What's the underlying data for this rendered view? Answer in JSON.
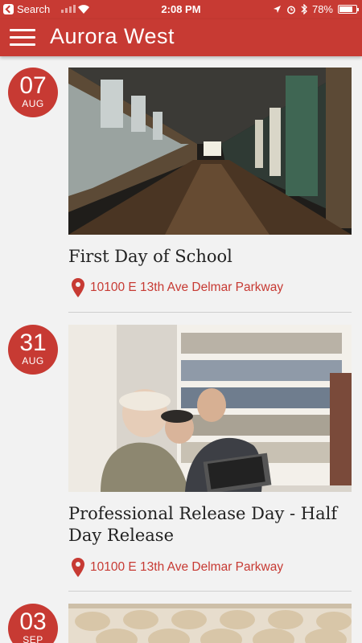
{
  "status_bar": {
    "back_label": "Search",
    "time": "2:08 PM",
    "battery": "78%",
    "battery_level": 0.78
  },
  "app_bar": {
    "title": "Aurora West",
    "menu_icon": "hamburger-menu-icon"
  },
  "colors": {
    "primary": "#c73a33",
    "background": "#f2f2f2"
  },
  "events": [
    {
      "day": "07",
      "month": "AUG",
      "title": "First Day of School",
      "location": "10100 E 13th Ave Delmar Parkway",
      "image": "school-hallway-photo"
    },
    {
      "day": "31",
      "month": "AUG",
      "title": "Professional Release Day - Half Day Release",
      "location": "10100 E 13th Ave Delmar Parkway",
      "image": "people-at-laptop-library-photo"
    },
    {
      "day": "03",
      "month": "SEP",
      "title": "",
      "location": "",
      "image": "auditorium-seats-photo"
    }
  ]
}
